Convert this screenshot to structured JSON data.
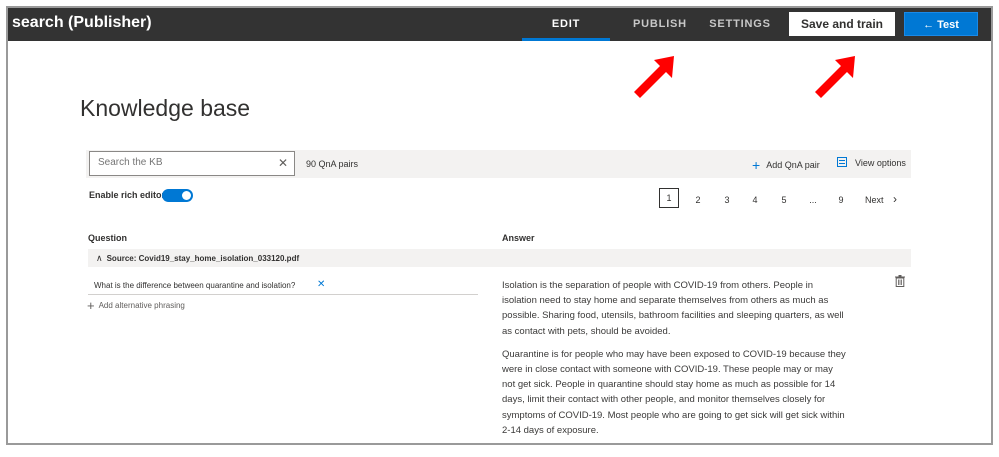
{
  "app": {
    "title": "search (Publisher)"
  },
  "nav": {
    "tabs": [
      {
        "label": "EDIT",
        "active": true
      },
      {
        "label": "PUBLISH",
        "active": false
      },
      {
        "label": "SETTINGS",
        "active": false
      }
    ],
    "save_label": "Save and train",
    "test_label": "← Test"
  },
  "colors": {
    "accent": "#0078d4",
    "topbar": "#333333",
    "annotation_arrow": "#ff0000"
  },
  "page": {
    "title": "Knowledge base"
  },
  "toolbar": {
    "search_placeholder": "Search the KB",
    "pair_count": "90 QnA pairs",
    "add_pair": "Add QnA pair",
    "view_options": "View options"
  },
  "rich_editor": {
    "label": "Enable rich editor",
    "enabled": true
  },
  "pagination": {
    "pages": [
      "1",
      "2",
      "3",
      "4",
      "5",
      "...",
      "9"
    ],
    "current": "1",
    "next": "Next"
  },
  "columns": {
    "question": "Question",
    "answer": "Answer"
  },
  "source": {
    "label": "Source: Covid19_stay_home_isolation_033120.pdf"
  },
  "qna": {
    "question": "What is the difference between quarantine and isolation?",
    "add_alt": "Add alternative phrasing",
    "answer_paragraphs": [
      "Isolation is the separation of people with COVID-19 from others. People in isolation need to stay home and separate themselves from others as much as possible. Sharing food, utensils, bathroom facilities and sleeping quarters, as well as contact with pets, should be avoided.",
      "Quarantine is for people who may have been exposed to COVID-19 because they were in close contact with someone with COVID-19. These people may or may not get sick. People in quarantine should stay home as much as possible for 14 days, limit their contact with other people, and monitor themselves closely for symptoms of COVID-19. Most people who are going to get sick will get sick within 2-14 days of exposure."
    ]
  }
}
